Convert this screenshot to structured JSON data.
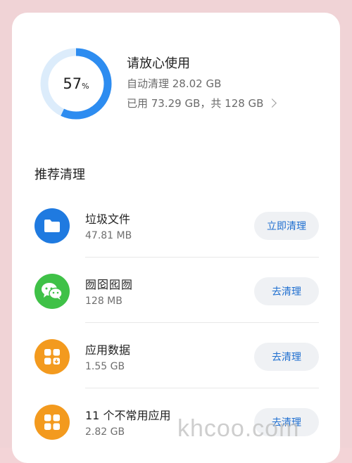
{
  "storage": {
    "percent": "57",
    "percent_sign": "%",
    "usage_fraction": 0.57,
    "status_title": "请放心使用",
    "auto_clean": "自动清理 28.02 GB",
    "used_total": "已用 73.29 GB，共 128 GB",
    "ring_color": "#2d8cf0",
    "ring_track_color": "#dcecfb"
  },
  "recommend": {
    "section_title": "推荐清理",
    "items": [
      {
        "name": "垃圾文件",
        "size": "47.81 MB",
        "button": "立即清理",
        "icon": "folder-icon",
        "icon_color": "#1f7ae0"
      },
      {
        "name": "囫囵囮囫",
        "size": "128 MB",
        "button": "去清理",
        "icon": "wechat-icon",
        "icon_color": "#3fc147"
      },
      {
        "name": "应用数据",
        "size": "1.55 GB",
        "button": "去清理",
        "icon": "app-data-icon",
        "icon_color": "#f39a1e"
      },
      {
        "name": "11 个不常用应用",
        "size": "2.82 GB",
        "button": "去清理",
        "icon": "apps-grid-icon",
        "icon_color": "#f39a1e"
      }
    ]
  },
  "watermark": "khcoo.com"
}
